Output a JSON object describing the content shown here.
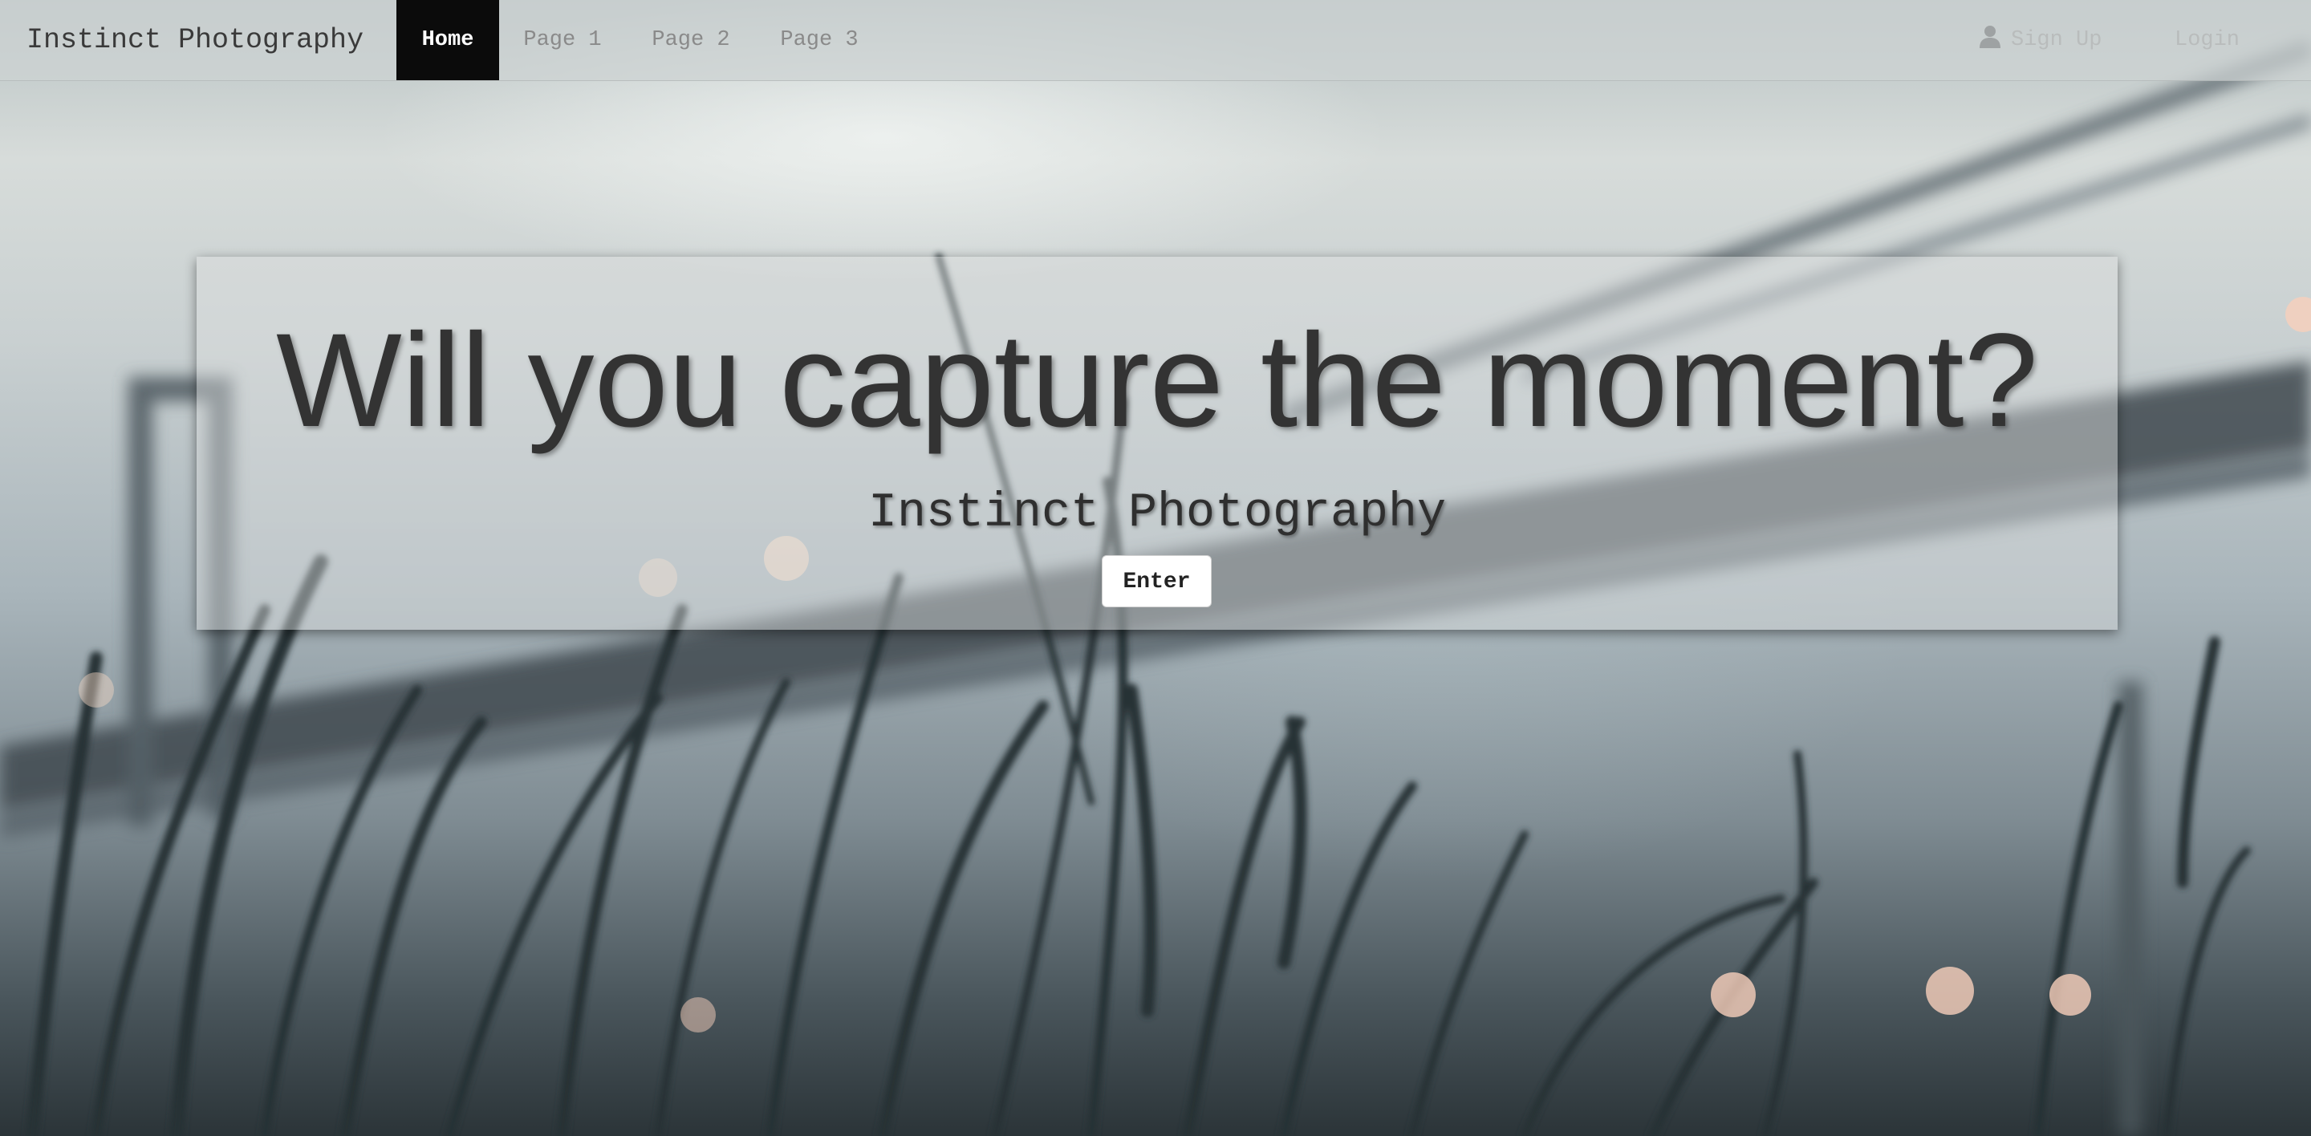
{
  "navbar": {
    "brand": "Instinct Photography",
    "items": [
      {
        "label": "Home",
        "active": true
      },
      {
        "label": "Page 1",
        "active": false
      },
      {
        "label": "Page 2",
        "active": false
      },
      {
        "label": "Page 3",
        "active": false
      }
    ],
    "right": {
      "sign_up_label": "Sign Up",
      "sign_up_icon": "user-icon",
      "login_label": "Login"
    }
  },
  "hero": {
    "title": "Will you capture the moment?",
    "subtitle": "Instinct Photography",
    "button_label": "Enter"
  },
  "background": {
    "description_icon": "bridge-photo",
    "accent_sky": "#d7dcda",
    "grass_color": "#2b3438"
  }
}
